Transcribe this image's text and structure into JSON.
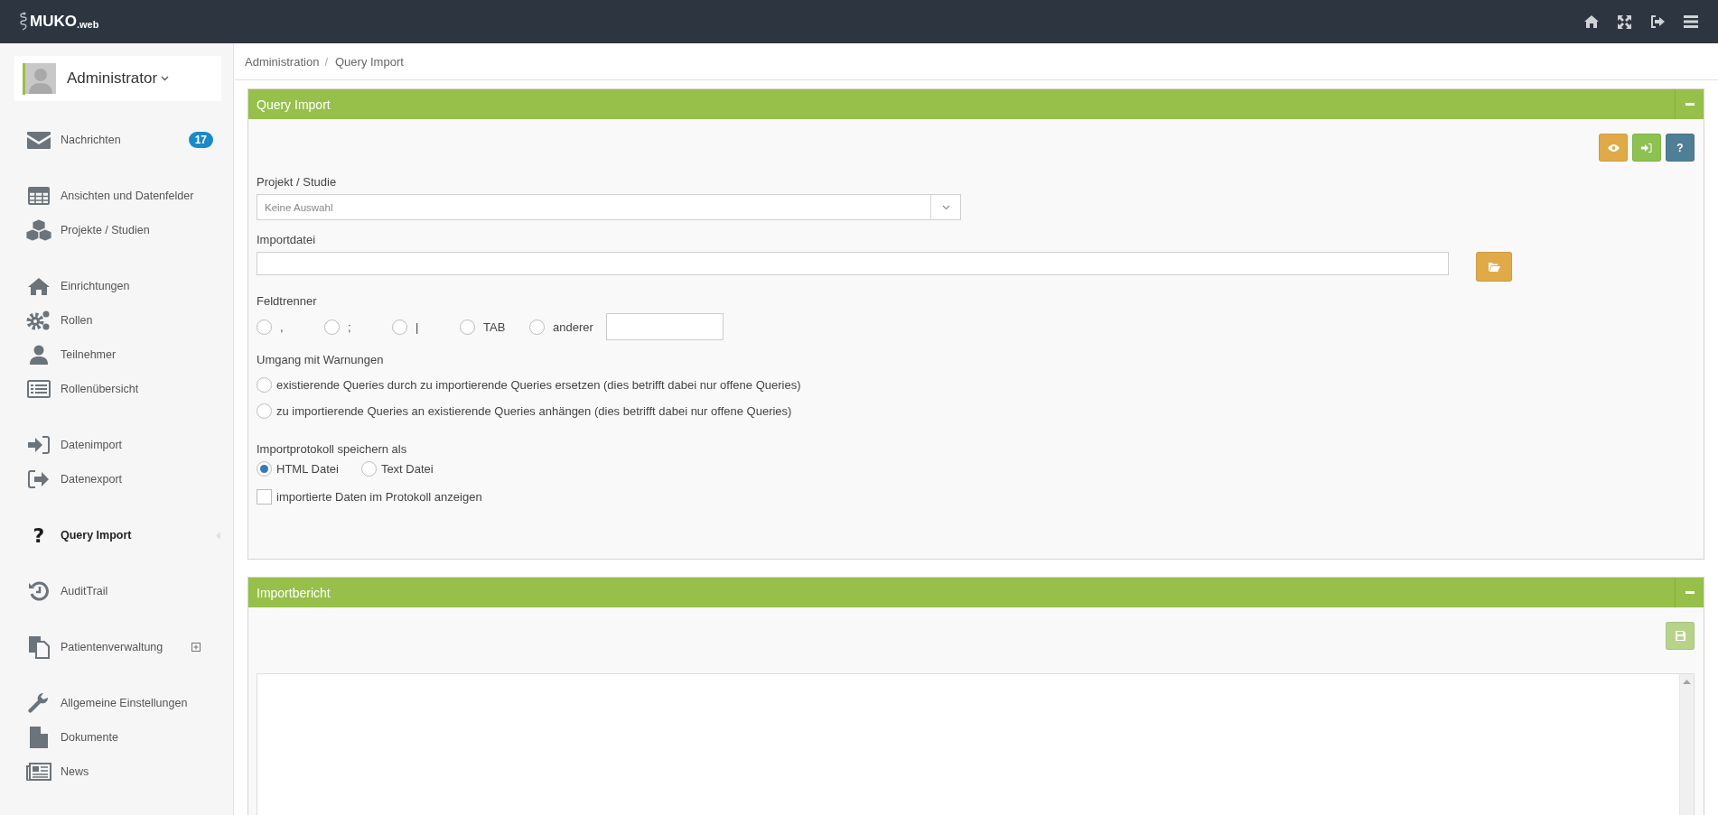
{
  "topbar": {
    "logo_main": "MUKO",
    "logo_suffix": ".web"
  },
  "sidebar": {
    "user": {
      "name": "Administrator"
    },
    "groups": [
      {
        "items": [
          {
            "label": "Nachrichten",
            "badge": "17",
            "kind": "link",
            "selected": false
          }
        ]
      },
      {
        "items": [
          {
            "label": "Ansichten und Datenfelder",
            "kind": "link",
            "selected": false
          },
          {
            "label": "Projekte / Studien",
            "kind": "link",
            "selected": false
          }
        ]
      },
      {
        "items": [
          {
            "label": "Einrichtungen",
            "kind": "link",
            "selected": false
          },
          {
            "label": "Rollen",
            "kind": "link",
            "selected": false
          },
          {
            "label": "Teilnehmer",
            "kind": "link",
            "selected": false
          },
          {
            "label": "Rollenübersicht",
            "kind": "link",
            "selected": false
          }
        ]
      },
      {
        "items": [
          {
            "label": "Datenimport",
            "kind": "link",
            "selected": false
          },
          {
            "label": "Datenexport",
            "kind": "link",
            "selected": false
          }
        ]
      },
      {
        "items": [
          {
            "label": "Query Import",
            "glyph": "?",
            "kind": "link",
            "selected": true
          }
        ]
      },
      {
        "items": [
          {
            "label": "AuditTrail",
            "kind": "link",
            "selected": false
          }
        ]
      },
      {
        "items": [
          {
            "label": "Patientenverwaltung",
            "kind": "submenu",
            "selected": false
          }
        ]
      },
      {
        "items": [
          {
            "label": "Allgemeine Einstellungen",
            "kind": "link",
            "selected": false
          },
          {
            "label": "Dokumente",
            "kind": "link",
            "selected": false
          },
          {
            "label": "News",
            "kind": "link",
            "selected": false
          }
        ]
      }
    ]
  },
  "breadcrumb": {
    "separator": "/",
    "items": [
      "Administration",
      "Query Import"
    ]
  },
  "import_panel": {
    "title": "Query Import",
    "toolbar": [
      {
        "kind": "preview"
      },
      {
        "kind": "import"
      },
      {
        "kind": "help",
        "label": "?"
      }
    ],
    "project": {
      "label": "Projekt / Studie",
      "placeholder": "Keine Auswahl"
    },
    "import_file": {
      "label": "Importdatei"
    },
    "separator": {
      "label": "Feldtrenner",
      "options": [
        {
          "label": ",",
          "selected": false
        },
        {
          "label": ";",
          "selected": false
        },
        {
          "label": "|",
          "selected": false
        },
        {
          "label": "TAB",
          "selected": false
        },
        {
          "label": "anderer",
          "selected": false
        }
      ]
    },
    "warnings": {
      "label": "Umgang mit Warnungen",
      "options": [
        {
          "label": "existierende Queries durch zu importierende Queries ersetzen (dies betrifft dabei nur offene Queries)",
          "selected": false
        },
        {
          "label": "zu importierende Queries an existierende Queries anhängen (dies betrifft dabei nur offene Queries)",
          "selected": false
        }
      ]
    },
    "protocol": {
      "label": "Importprotokoll speichern als",
      "options": [
        {
          "label": "HTML Datei",
          "selected": true
        },
        {
          "label": "Text Datei",
          "selected": false
        }
      ]
    },
    "show_data": {
      "label": "importierte Daten im Protokoll anzeigen",
      "checked": false
    }
  },
  "report_panel": {
    "title": "Importbericht",
    "save_disabled": true
  }
}
